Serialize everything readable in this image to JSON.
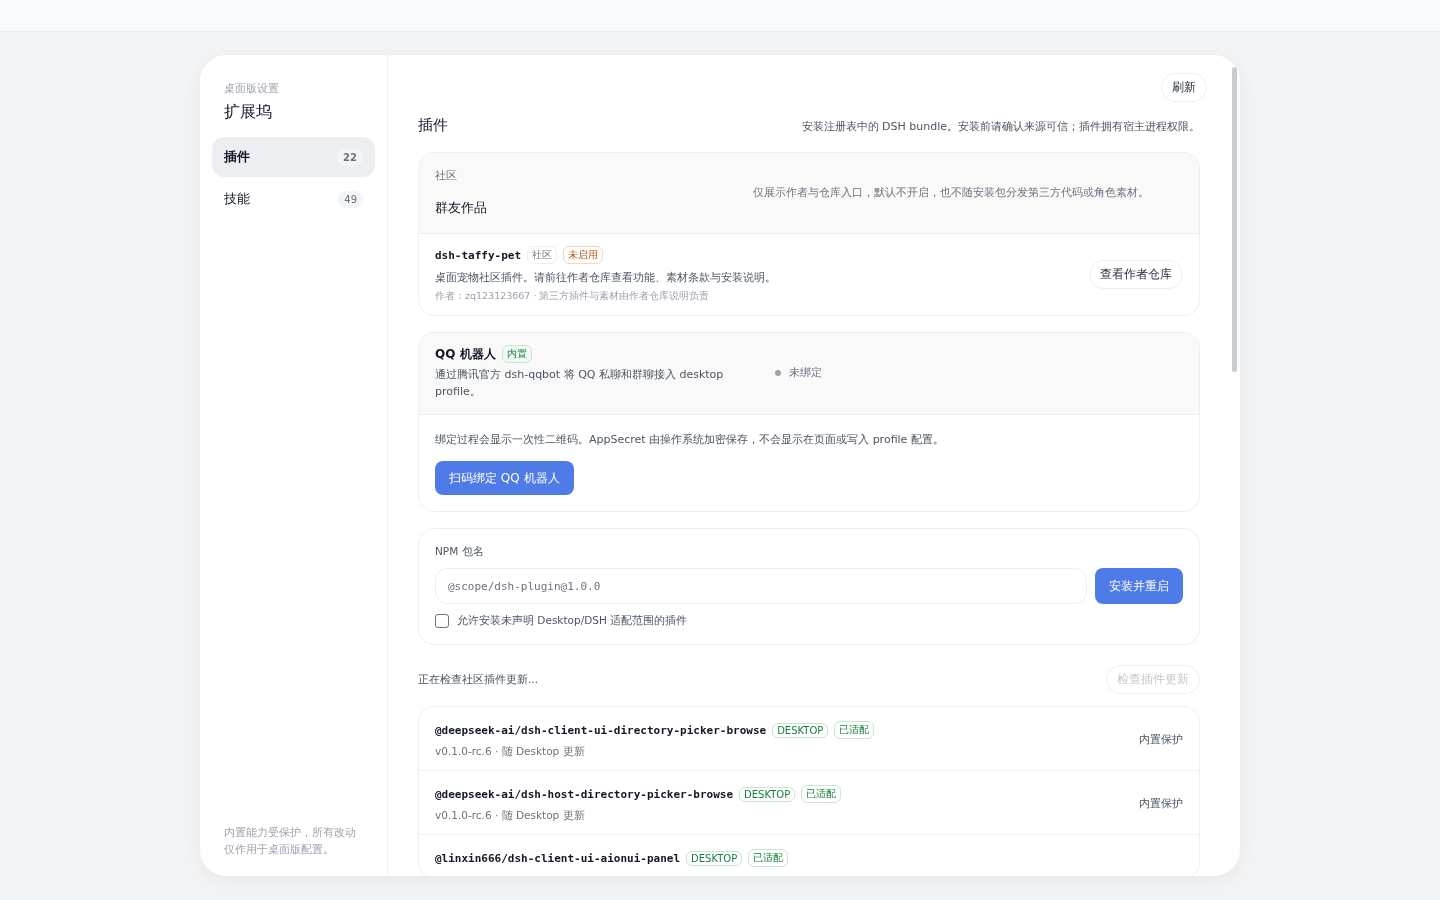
{
  "sidebar": {
    "eyebrow": "桌面版设置",
    "title": "扩展坞",
    "items": [
      {
        "label": "插件",
        "count": "22",
        "selected": true
      },
      {
        "label": "技能",
        "count": "49",
        "selected": false
      }
    ],
    "footer": "内置能力受保护，所有改动仅作用于桌面版配置。"
  },
  "refresh_button": "刷新",
  "section": {
    "title": "插件",
    "description": "安装注册表中的 DSH bundle。安装前请确认来源可信；插件拥有宿主进程权限。"
  },
  "community": {
    "eyebrow": "社区",
    "title": "群友作品",
    "note": "仅展示作者与仓库入口，默认不开启，也不随安装包分发第三方代码或角色素材。",
    "items": [
      {
        "name": "dsh-taffy-pet",
        "tags": [
          {
            "label": "社区",
            "kind": "neutral"
          },
          {
            "label": "未启用",
            "kind": "warning"
          }
        ],
        "description": "桌面宠物社区插件。请前往作者仓库查看功能、素材条款与安装说明。",
        "meta": "作者：zq123123667 · 第三方插件与素材由作者仓库说明负责",
        "action": "查看作者仓库"
      }
    ]
  },
  "qq_bot": {
    "title": "QQ 机器人",
    "tag": "内置",
    "description": "通过腾讯官方 dsh-qqbot 将 QQ 私聊和群聊接入 desktop profile。",
    "status": "未绑定",
    "bound": false,
    "note": "绑定过程会显示一次性二维码。AppSecret 由操作系统加密保存，不会显示在页面或写入 profile 配置。",
    "button": "扫码绑定 QQ 机器人"
  },
  "npm": {
    "label": "NPM 包名",
    "placeholder": "@scope/dsh-plugin@1.0.0",
    "button": "安装并重启",
    "allow_undeclared": {
      "label": "允许安装未声明 Desktop/DSH 适配范围的插件",
      "checked": false
    }
  },
  "updates": {
    "status": "正在检查社区插件更新...",
    "button": "检查插件更新",
    "button_disabled": true
  },
  "plugins": [
    {
      "name": "@deepseek-ai/dsh-client-ui-directory-picker-browse",
      "tags": [
        "DESKTOP",
        "已适配"
      ],
      "version": "v0.1.0-rc.6 · 随 Desktop 更新",
      "state": "内置保护"
    },
    {
      "name": "@deepseek-ai/dsh-host-directory-picker-browse",
      "tags": [
        "DESKTOP",
        "已适配"
      ],
      "version": "v0.1.0-rc.6 · 随 Desktop 更新",
      "state": "内置保护"
    },
    {
      "name": "@linxin666/dsh-client-ui-aionui-panel",
      "tags": [
        "DESKTOP",
        "已适配"
      ]
    }
  ]
}
